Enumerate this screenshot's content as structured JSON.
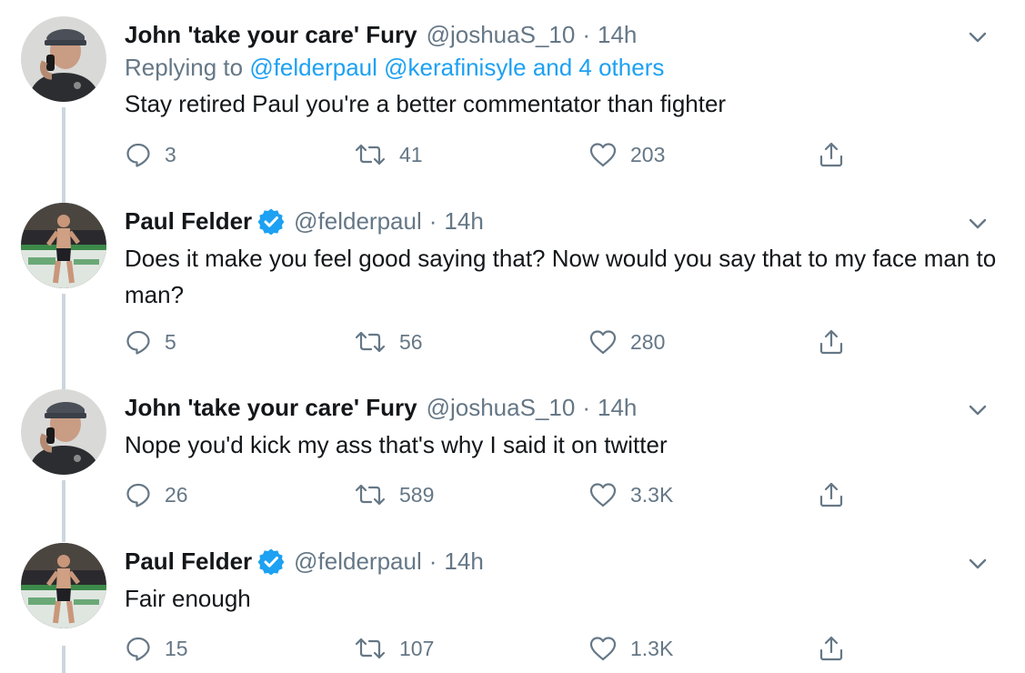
{
  "tweets": [
    {
      "name": "John 'take your care' Fury",
      "handle": "@joshuaS_10",
      "time": "14h",
      "verified": false,
      "avatar": "man-on-phone-avatar",
      "reply_to": {
        "prefix": "Replying to",
        "mentions": "@felderpaul @kerafinisyle",
        "suffix": "and 4 others"
      },
      "text": "Stay retired Paul you're a better commentator than fighter",
      "replies": "3",
      "retweets": "41",
      "likes": "203"
    },
    {
      "name": "Paul Felder",
      "handle": "@felderpaul",
      "time": "14h",
      "verified": true,
      "avatar": "fighter-in-octagon-avatar",
      "text": "Does it make you feel good saying that? Now would you say that to my face man to man?",
      "replies": "5",
      "retweets": "56",
      "likes": "280"
    },
    {
      "name": "John 'take your care' Fury",
      "handle": "@joshuaS_10",
      "time": "14h",
      "verified": false,
      "avatar": "man-on-phone-avatar",
      "text": "Nope you'd kick my ass that's why I said it on twitter",
      "replies": "26",
      "retweets": "589",
      "likes": "3.3K"
    },
    {
      "name": "Paul Felder",
      "handle": "@felderpaul",
      "time": "14h",
      "verified": true,
      "avatar": "fighter-in-octagon-avatar",
      "text": "Fair enough",
      "replies": "15",
      "retweets": "107",
      "likes": "1.3K"
    }
  ],
  "separator": "·",
  "icons": {
    "reply": "reply-icon",
    "retweet": "retweet-icon",
    "like": "heart-icon",
    "share": "share-icon",
    "menu": "chevron-down-icon",
    "verified": "verified-badge-icon"
  },
  "colors": {
    "text": "#14171a",
    "secondary": "#657786",
    "link": "#1da1f2",
    "thread_line": "#ccd6dd"
  }
}
